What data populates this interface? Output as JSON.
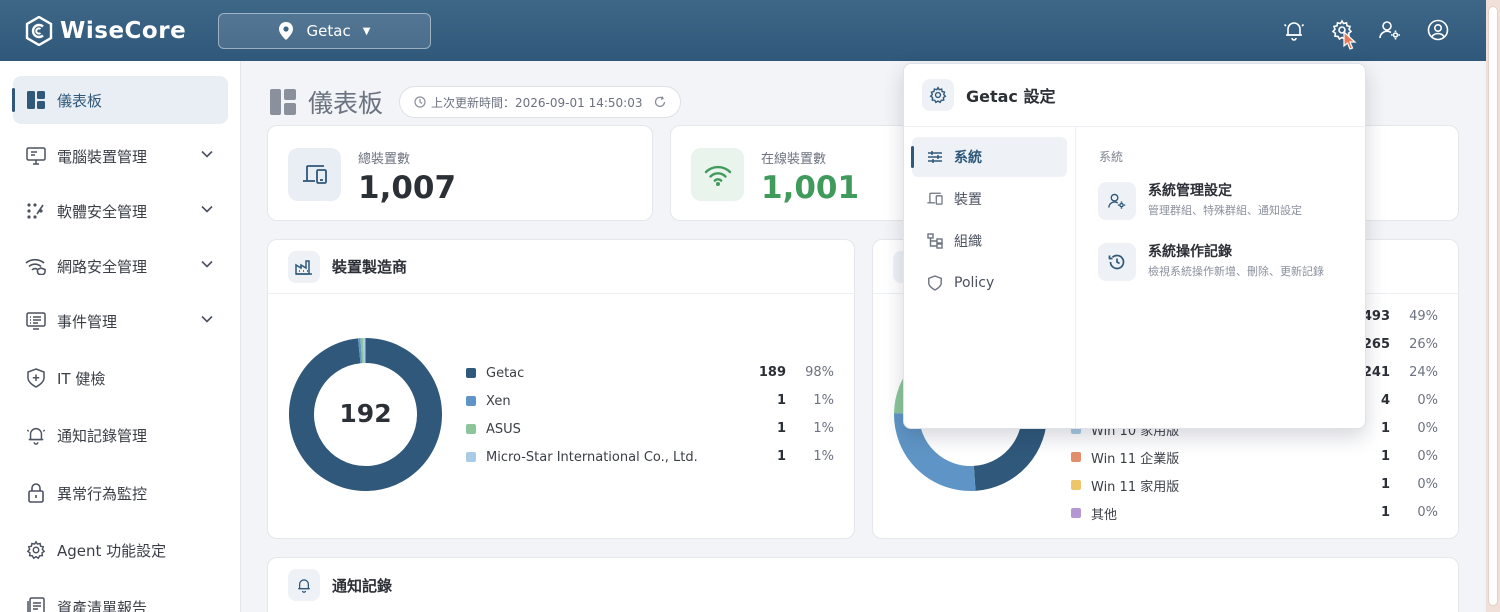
{
  "app": {
    "name": "WiseCore"
  },
  "header": {
    "site": "Getac"
  },
  "sidebar": {
    "items": [
      {
        "label": "儀表板",
        "icon": "dashboard-icon",
        "active": true
      },
      {
        "label": "電腦裝置管理",
        "icon": "monitor-icon"
      },
      {
        "label": "軟體安全管理",
        "icon": "software-icon"
      },
      {
        "label": "網路安全管理",
        "icon": "wifi-shield-icon"
      },
      {
        "label": "事件管理",
        "icon": "event-list-icon"
      },
      {
        "label": "IT 健檢",
        "icon": "shield-plus-icon"
      },
      {
        "label": "通知記錄管理",
        "icon": "bell-icon"
      },
      {
        "label": "異常行為監控",
        "icon": "lock-icon"
      },
      {
        "label": "Agent 功能設定",
        "icon": "gear-icon"
      },
      {
        "label": "資產清單報告",
        "icon": "report-icon"
      }
    ]
  },
  "page": {
    "title": "儀表板",
    "last_update": "上次更新時間：2026-09-01 14:50:03"
  },
  "stats": {
    "total": {
      "label": "總裝置數",
      "value": "1,007"
    },
    "online": {
      "label": "在線裝置數",
      "value": "1,001"
    }
  },
  "manufacturer_card": {
    "title": "裝置製造商",
    "center": "192",
    "rows": [
      {
        "name": "Getac",
        "count": "189",
        "pct": "98%",
        "color": "#2f587a"
      },
      {
        "name": "Xen",
        "count": "1",
        "pct": "1%",
        "color": "#5f95c6"
      },
      {
        "name": "ASUS",
        "count": "1",
        "pct": "1%",
        "color": "#8cc59a"
      },
      {
        "name": "Micro-Star International Co., Ltd.",
        "count": "1",
        "pct": "1%",
        "color": "#a9cbe5"
      }
    ]
  },
  "os_card": {
    "rows": [
      {
        "name": "",
        "count": "493",
        "pct": "49%",
        "color": "#2f587a"
      },
      {
        "name": "",
        "count": "265",
        "pct": "26%",
        "color": "#5f95c6"
      },
      {
        "name": "",
        "count": "241",
        "pct": "24%",
        "color": "#8cc59a"
      },
      {
        "name": "",
        "count": "4",
        "pct": "0%",
        "color": "#a9cbe5"
      },
      {
        "name": "Win 10 家用版",
        "count": "1",
        "pct": "0%",
        "color": "#a9cbe5"
      },
      {
        "name": "Win 11 企業版",
        "count": "1",
        "pct": "0%",
        "color": "#e48d6c"
      },
      {
        "name": "Win 11 家用版",
        "count": "1",
        "pct": "0%",
        "color": "#efc56a"
      },
      {
        "name": "其他",
        "count": "1",
        "pct": "0%",
        "color": "#b597d4"
      }
    ]
  },
  "notify_card": {
    "title": "通知記錄"
  },
  "settings_popup": {
    "title": "Getac 設定",
    "nav": [
      {
        "label": "系統",
        "active": true
      },
      {
        "label": "裝置"
      },
      {
        "label": "組織"
      },
      {
        "label": "Policy"
      }
    ],
    "section": "系統",
    "options": [
      {
        "title": "系統管理設定",
        "desc": "管理群組、特殊群組、通知設定"
      },
      {
        "title": "系統操作記錄",
        "desc": "檢視系統操作新增、刪除、更新記錄"
      }
    ]
  },
  "colors": {
    "topbar": "#2f587a",
    "accent": "#2f587a",
    "online_green": "#3f9a5c"
  }
}
